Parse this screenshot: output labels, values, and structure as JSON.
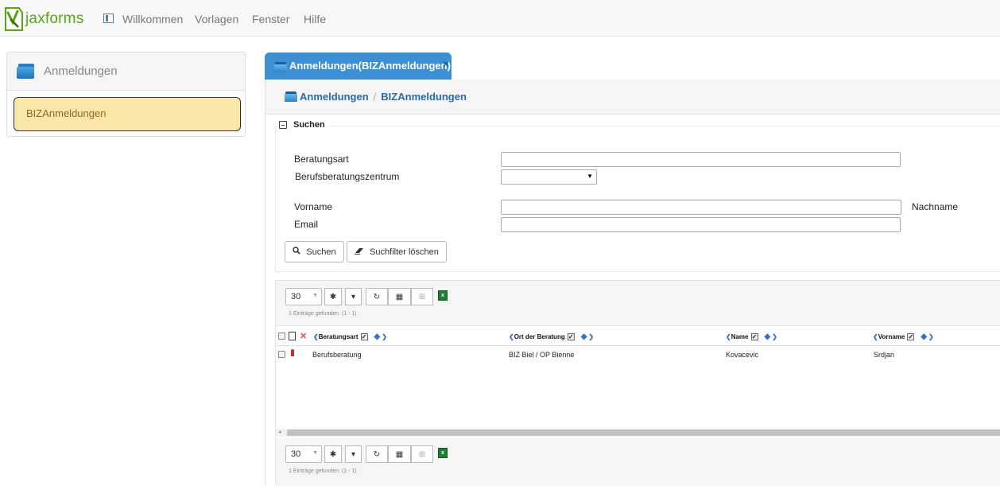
{
  "app": {
    "logo_text": "jaxforms",
    "brand_color": "#58a41b",
    "menu": [
      "Willkommen",
      "Vorlagen",
      "Fenster",
      "Hilfe"
    ]
  },
  "left_panel": {
    "title": "Anmeldungen",
    "items": [
      {
        "label": "BIZAnmeldungen"
      }
    ]
  },
  "main": {
    "tab_label": "Anmeldungen(BIZAnmeldungen)",
    "breadcrumb": [
      "Anmeldungen",
      "BIZAnmeldungen"
    ],
    "search": {
      "legend": "Suchen",
      "fields": {
        "beratungsart": {
          "label": "Beratungsart",
          "value": ""
        },
        "berufsberatungszentrum": {
          "label": "Berufsberatungszentrum",
          "value": ""
        },
        "vorname": {
          "label": "Vorname",
          "value": ""
        },
        "nachname": {
          "label": "Nachname"
        },
        "email": {
          "label": "Email",
          "value": ""
        }
      },
      "search_button": "Suchen",
      "clear_button": "Suchfilter löschen"
    },
    "grid": {
      "page_size": "30",
      "found_text": "1 Einträge gefunden. (1 - 1)",
      "columns": [
        "Beratungsart",
        "Ort der Beratung",
        "Name",
        "Vorname"
      ],
      "rows": [
        {
          "beratungsart": "Berufsberatung",
          "ort": "BIZ Biel / OP Bienne",
          "name": "Kovacevic",
          "vorname": "Srdjan"
        }
      ]
    }
  },
  "colors": {
    "tab_blue": "#3d8fd4",
    "selected_item_bg": "#fbe7a8",
    "link_blue": "#2a6aa8"
  }
}
